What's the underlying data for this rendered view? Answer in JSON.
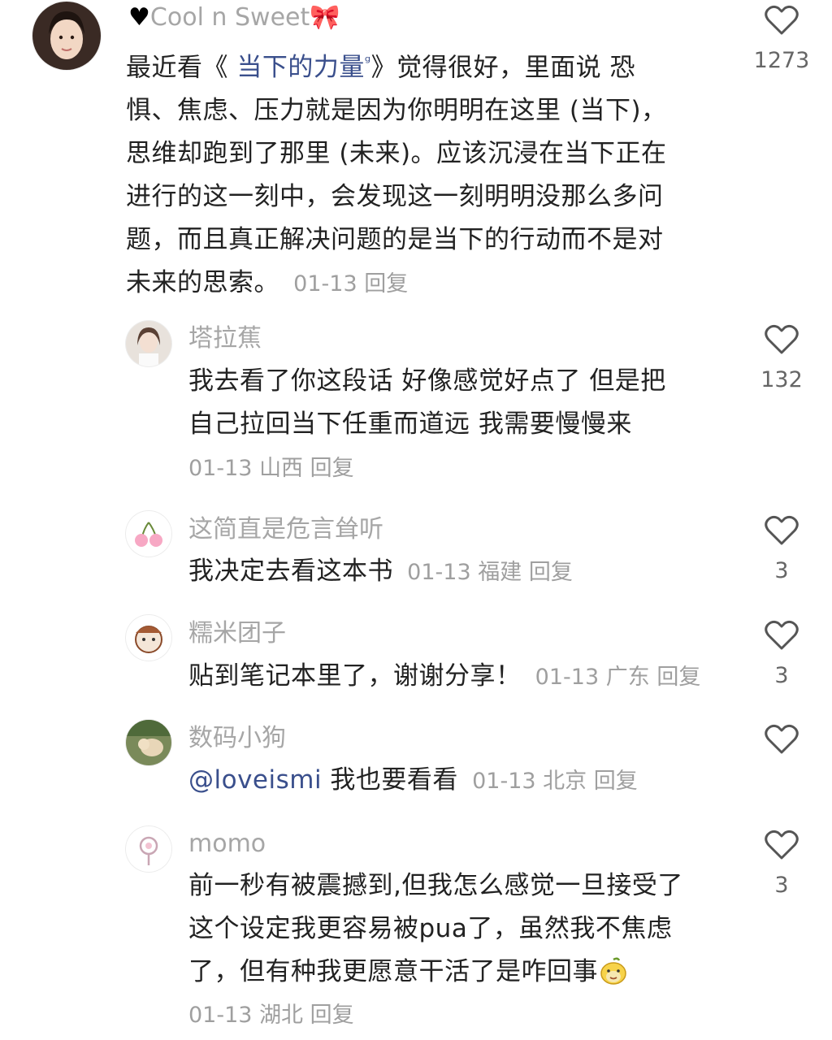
{
  "comments": [
    {
      "username": "Cool n Sweet",
      "segments": [
        "最近看《 ",
        "当下的力量",
        " 》觉得很好，里面说 恐惧、焦虑、压力就是因为你明明在这里 (当下)，思维却跑到了那里 (未来)。应该沉浸在当下正在进行的这一刻中，会发现这一刻明明没那么多问题，而且真正解决问题的是当下的行动而不是对未来的思索。"
      ],
      "lines": [
        "最近看《 当下的力量 》觉得很好，里面说 恐",
        "惧、焦虑、压力就是因为你明明在这里 (当下)，",
        "思维却跑到了那里 (未来)。应该沉浸在当下正在",
        "进行的这一刻中，会发现这一刻明明没那么多问",
        "题，而且真正解决问题的是当下的行动而不是对",
        "未来的思索。"
      ],
      "date": "01-13",
      "reply": "回复",
      "likes": "1273"
    },
    {
      "username": "塔拉蕉",
      "lines": [
        "我去看了你这段话 好像感觉好点了 但是把",
        "自己拉回当下任重而道远 我需要慢慢来"
      ],
      "date": "01-13",
      "location": "山西",
      "reply": "回复",
      "likes": "132"
    },
    {
      "username": "这简直是危言耸听",
      "text": "我决定去看这本书",
      "date": "01-13",
      "location": "福建",
      "reply": "回复",
      "likes": "3"
    },
    {
      "username": "糯米团子",
      "text": "贴到笔记本里了，谢谢分享！",
      "date": "01-13",
      "location": "广东",
      "reply": "回复",
      "likes": "3"
    },
    {
      "username": "数码小狗",
      "mention": "@loveismi",
      "text": " 我也要看看",
      "date": "01-13",
      "location": "北京",
      "reply": "回复",
      "likes": ""
    },
    {
      "username": "momo",
      "lines": [
        "前一秒有被震撼到,但我怎么感觉一旦接受了",
        "这个设定我更容易被pua了，虽然我不焦虑",
        "了，但有种我更愿意干活了是咋回事"
      ],
      "date": "01-13",
      "location": "湖北",
      "reply": "回复",
      "likes": "3"
    }
  ],
  "icons": {
    "heart": "heart-outline-icon",
    "black_heart": "black-heart-emoji",
    "bow": "pink-bow-emoji",
    "search": "search-icon",
    "smile": "smiling-emoji"
  },
  "colors": {
    "link": "#3a4f8c",
    "meta": "#9f9f9f",
    "username": "#a6a6a6",
    "text": "#222222"
  }
}
